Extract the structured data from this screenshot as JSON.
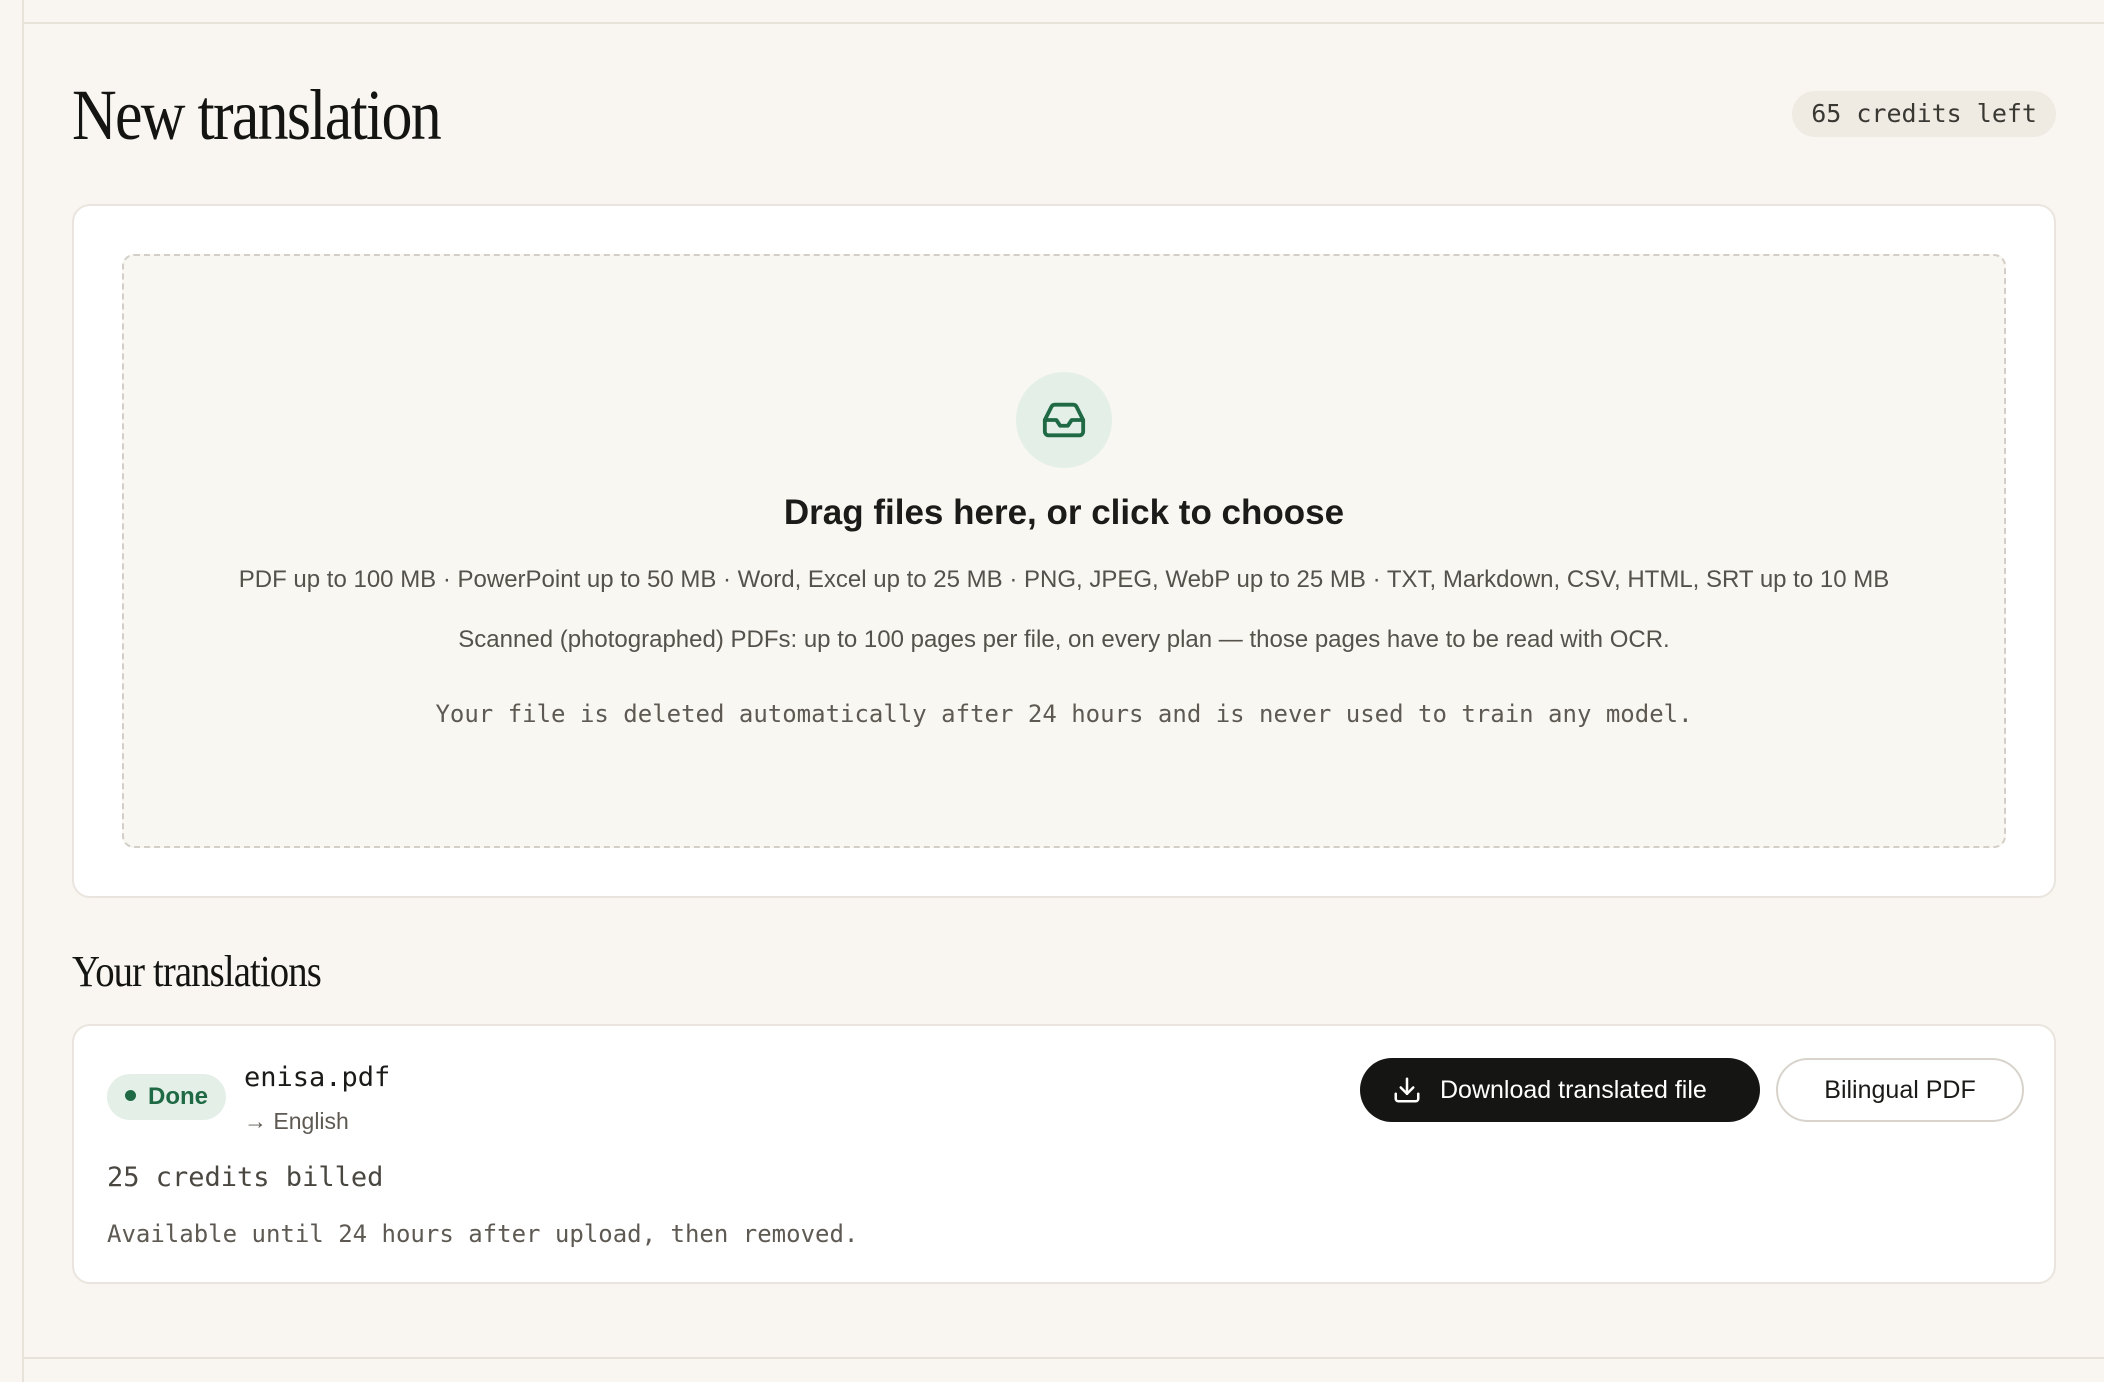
{
  "header": {
    "title": "New translation",
    "credits": "65 credits left"
  },
  "upload": {
    "icon": "inbox-icon",
    "title": "Drag files here, or click to choose",
    "limits": "PDF up to 100 MB · PowerPoint up to 50 MB · Word, Excel up to 25 MB · PNG, JPEG, WebP up to 25 MB · TXT, Markdown, CSV, HTML, SRT up to 10 MB",
    "ocr_note": "Scanned (photographed) PDFs: up to 100 pages per file, on every plan — those pages have to be read with OCR.",
    "privacy_note": "Your file is deleted automatically after 24 hours and is never used to train any model."
  },
  "translations": {
    "section_title": "Your translations",
    "items": [
      {
        "status": "Done",
        "file_name": "enisa.pdf",
        "target": "→ English",
        "credits_billed": "25 credits billed",
        "availability": "Available until 24 hours after upload, then removed.",
        "download_label": "Download translated file",
        "bilingual_label": "Bilingual PDF"
      }
    ]
  },
  "colors": {
    "background": "#f9f6f1",
    "accent_green": "#1f6a45",
    "accent_green_soft": "#e4efe8",
    "primary_button": "#151513"
  }
}
